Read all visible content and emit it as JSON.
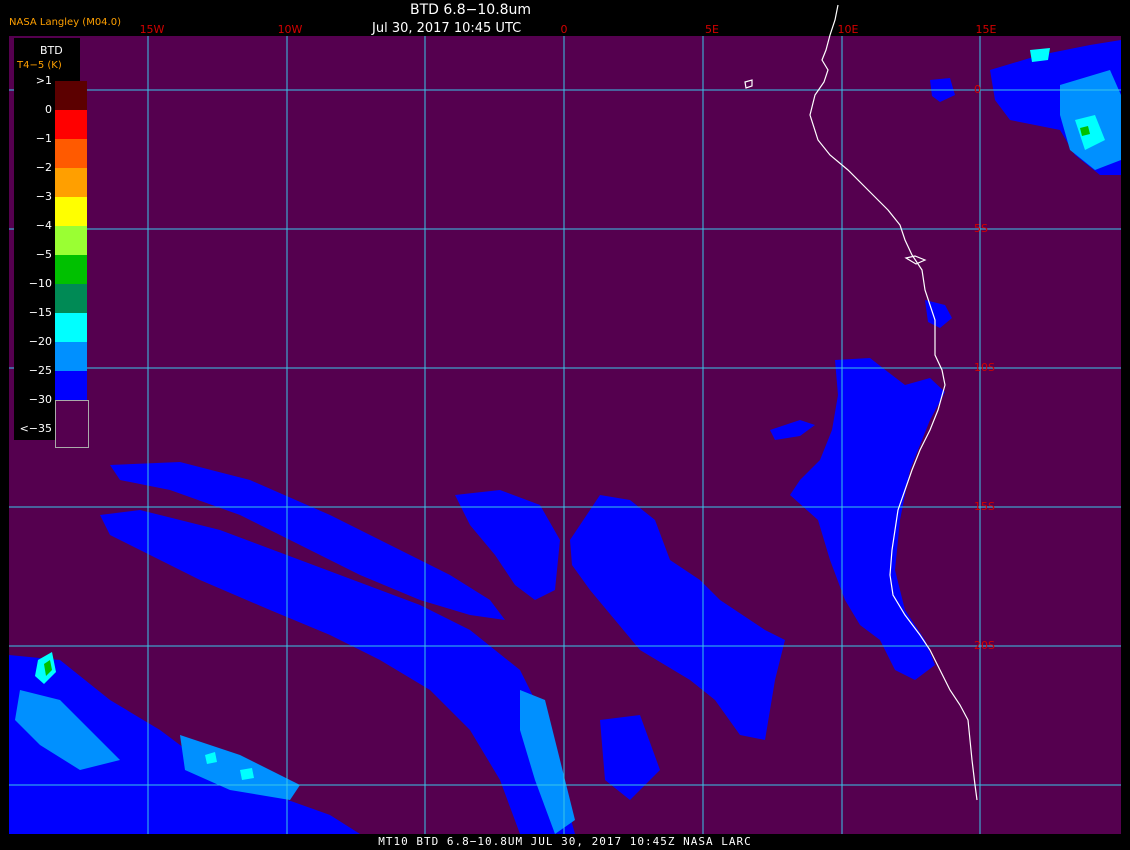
{
  "header": {
    "org": "NASA Langley (M04.0)",
    "title": "BTD 6.8−10.8um",
    "datetime": "Jul 30, 2017 10:45 UTC"
  },
  "longitude_labels": [
    "15W",
    "10W",
    "0",
    "5E",
    "10E",
    "15E"
  ],
  "latitude_labels": [
    "0",
    "5S",
    "10S",
    "15S",
    "20S"
  ],
  "legend": {
    "title": "BTD",
    "unit": "T4−5 (K)",
    "entries": [
      {
        "label": ">1",
        "color": "#5c0000"
      },
      {
        "label": "0",
        "color": "#ff0000"
      },
      {
        "label": "−1",
        "color": "#ff5a00"
      },
      {
        "label": "−2",
        "color": "#ff9f00"
      },
      {
        "label": "−3",
        "color": "#ffff00"
      },
      {
        "label": "−4",
        "color": "#9aff33"
      },
      {
        "label": "−5",
        "color": "#00c000"
      },
      {
        "label": "−10",
        "color": "#008a55"
      },
      {
        "label": "−15",
        "color": "#00ffff"
      },
      {
        "label": "−20",
        "color": "#0090ff"
      },
      {
        "label": "−25",
        "color": "#0000ff"
      },
      {
        "label": "−30",
        "color": "#55004f"
      },
      {
        "label": "<−35",
        "color": ""
      }
    ]
  },
  "colors": {
    "background": "#55004f",
    "cloud": "#0000ff",
    "cloud_edge": "#0090ff",
    "grid": "#39c6e8",
    "coast": "#ffffff"
  },
  "footer": "MT10  BTD 6.8−10.8UM   JUL 30, 2017 10:45Z   NASA LARC"
}
